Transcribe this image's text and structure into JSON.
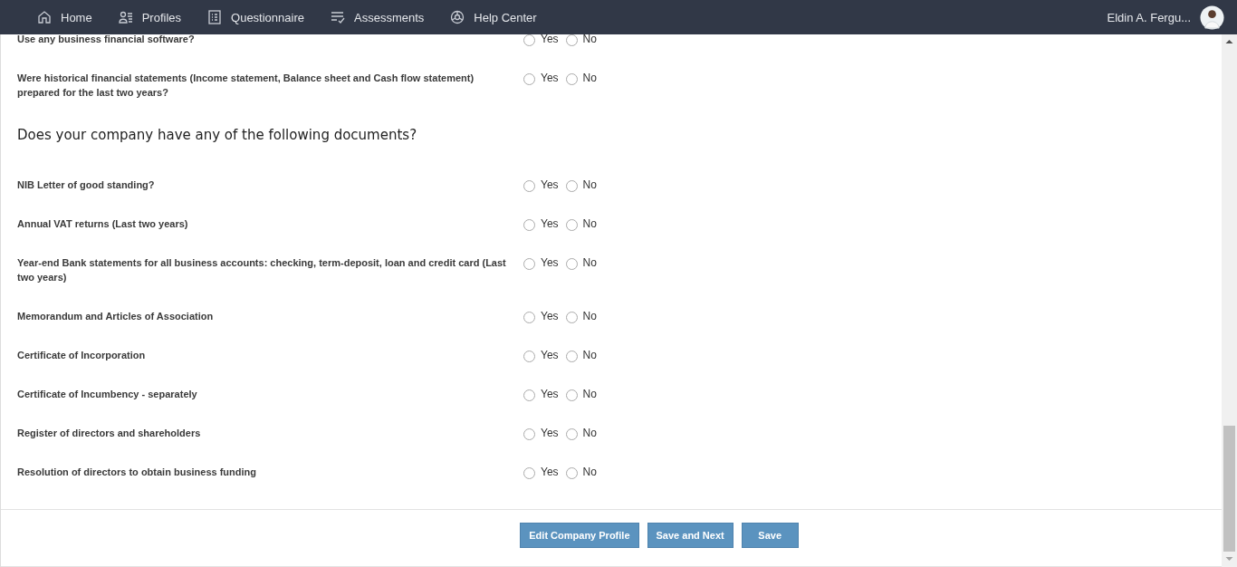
{
  "nav": {
    "items": [
      {
        "label": "Home",
        "kind": "home"
      },
      {
        "label": "Profiles",
        "kind": "profiles"
      },
      {
        "label": "Questionnaire",
        "kind": "questionnaire"
      },
      {
        "label": "Assessments",
        "kind": "assessments"
      },
      {
        "label": "Help Center",
        "kind": "help"
      }
    ],
    "user": {
      "name": "Eldin A. Fergu..."
    }
  },
  "form": {
    "items": [
      {
        "kind": "question",
        "text": "Use any business financial software?",
        "options": [
          {
            "label": "Yes",
            "selected": false
          },
          {
            "label": "No",
            "selected": false
          }
        ]
      },
      {
        "kind": "question",
        "text": "Were historical financial statements (Income statement, Balance sheet and Cash flow statement) prepared for the last two years?",
        "options": [
          {
            "label": "Yes",
            "selected": false
          },
          {
            "label": "No",
            "selected": false
          }
        ]
      },
      {
        "kind": "heading",
        "text": "Does your company have any of the following documents?"
      },
      {
        "kind": "question",
        "text": "NIB Letter of good standing?",
        "options": [
          {
            "label": "Yes",
            "selected": false
          },
          {
            "label": "No",
            "selected": false
          }
        ]
      },
      {
        "kind": "question",
        "text": "Annual VAT returns (Last two years)",
        "options": [
          {
            "label": "Yes",
            "selected": false
          },
          {
            "label": "No",
            "selected": false
          }
        ]
      },
      {
        "kind": "question",
        "text": "Year-end Bank statements for all business accounts: checking, term-deposit, loan and credit card (Last two years)",
        "options": [
          {
            "label": "Yes",
            "selected": false
          },
          {
            "label": "No",
            "selected": false
          }
        ]
      },
      {
        "kind": "question",
        "text": "Memorandum and Articles of Association",
        "options": [
          {
            "label": "Yes",
            "selected": false
          },
          {
            "label": "No",
            "selected": false
          }
        ]
      },
      {
        "kind": "question",
        "text": "Certificate of Incorporation",
        "options": [
          {
            "label": "Yes",
            "selected": false
          },
          {
            "label": "No",
            "selected": false
          }
        ]
      },
      {
        "kind": "question",
        "text": "Certificate of Incumbency - separately",
        "options": [
          {
            "label": "Yes",
            "selected": false
          },
          {
            "label": "No",
            "selected": false
          }
        ]
      },
      {
        "kind": "question",
        "text": "Register of directors and shareholders",
        "options": [
          {
            "label": "Yes",
            "selected": false
          },
          {
            "label": "No",
            "selected": false
          }
        ]
      },
      {
        "kind": "question",
        "text": "Resolution of directors to obtain business funding",
        "options": [
          {
            "label": "Yes",
            "selected": false
          },
          {
            "label": "No",
            "selected": false
          }
        ]
      }
    ]
  },
  "buttons": [
    "Edit Company Profile",
    "Save and Next",
    "Save"
  ]
}
